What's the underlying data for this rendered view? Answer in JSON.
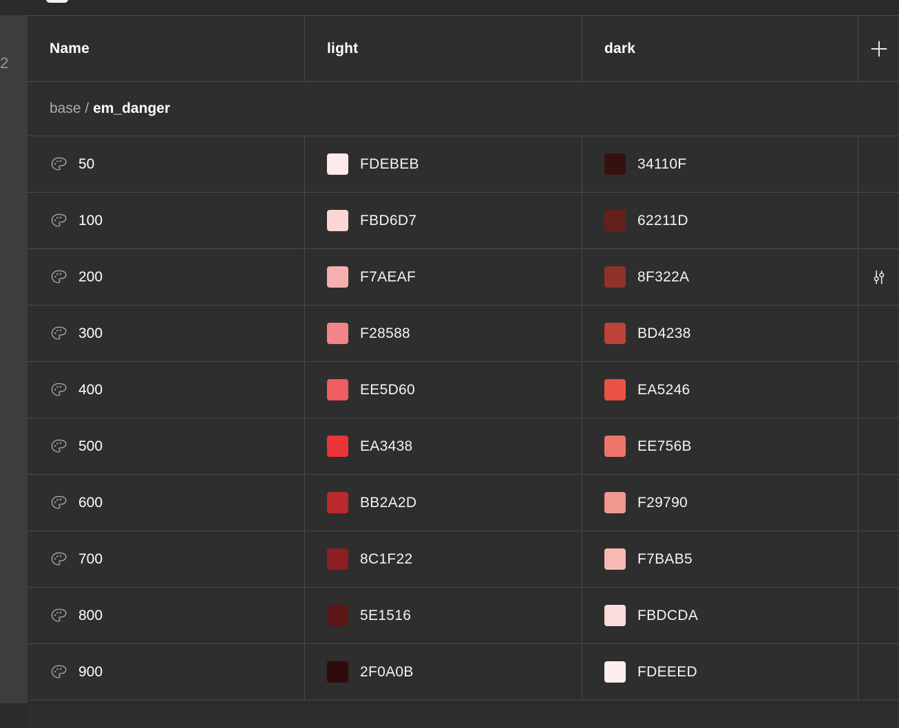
{
  "gutter": {
    "row_number": "2"
  },
  "table": {
    "columns": [
      {
        "key": "name",
        "label": "Name"
      },
      {
        "key": "light",
        "label": "light"
      },
      {
        "key": "dark",
        "label": "dark"
      }
    ],
    "add_column_button": {
      "icon": "plus-icon",
      "label": "+"
    },
    "group": {
      "prefix": "base",
      "separator": "/",
      "name": "em_danger"
    },
    "row_icon": "palette-icon",
    "row_action_icon": "sliders-icon",
    "rows": [
      {
        "name": "50",
        "light": "FDEBEB",
        "light_color": "#FDEBEB",
        "dark": "34110F",
        "dark_color": "#34110F",
        "action": ""
      },
      {
        "name": "100",
        "light": "FBD6D7",
        "light_color": "#FBD6D7",
        "dark": "62211D",
        "dark_color": "#62211D",
        "action": ""
      },
      {
        "name": "200",
        "light": "F7AEAF",
        "light_color": "#F7AEAF",
        "dark": "8F322A",
        "dark_color": "#8F322A",
        "action": "sliders-icon"
      },
      {
        "name": "300",
        "light": "F28588",
        "light_color": "#F28588",
        "dark": "BD4238",
        "dark_color": "#BD4238",
        "action": ""
      },
      {
        "name": "400",
        "light": "EE5D60",
        "light_color": "#EE5D60",
        "dark": "EA5246",
        "dark_color": "#EA5246",
        "action": ""
      },
      {
        "name": "500",
        "light": "EA3438",
        "light_color": "#EA3438",
        "dark": "EE756B",
        "dark_color": "#EE756B",
        "action": ""
      },
      {
        "name": "600",
        "light": "BB2A2D",
        "light_color": "#BB2A2D",
        "dark": "F29790",
        "dark_color": "#F29790",
        "action": ""
      },
      {
        "name": "700",
        "light": "8C1F22",
        "light_color": "#8C1F22",
        "dark": "F7BAB5",
        "dark_color": "#F7BAB5",
        "action": ""
      },
      {
        "name": "800",
        "light": "5E1516",
        "light_color": "#5E1516",
        "dark": "FBDCDA",
        "dark_color": "#FBDCDA",
        "action": ""
      },
      {
        "name": "900",
        "light": "2F0A0B",
        "light_color": "#2F0A0B",
        "dark": "FDEEED",
        "dark_color": "#FDEEED",
        "action": ""
      }
    ]
  },
  "theme": {
    "page_bg": "#2b2b2b",
    "row_bg": "#2e2e2e",
    "gutter_bg": "#3d3d3d",
    "border": "#4a4a4a",
    "text": "#ffffff",
    "muted_text": "#adadad"
  }
}
